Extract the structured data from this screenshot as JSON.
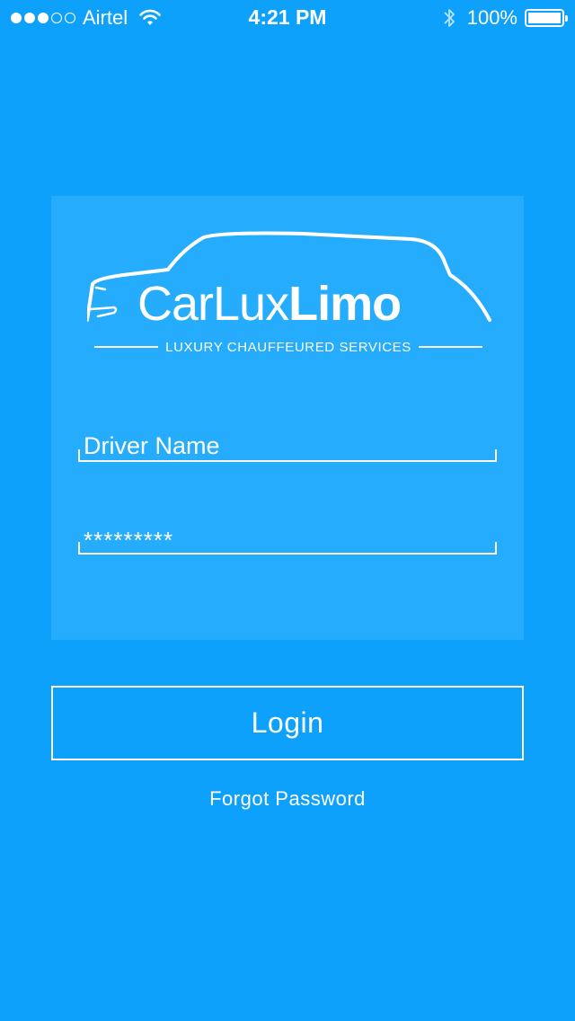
{
  "status_bar": {
    "carrier": "Airtel",
    "time": "4:21 PM",
    "battery": "100%",
    "signal_strength": 3,
    "signal_max": 5
  },
  "logo": {
    "name_light": "CarLux",
    "name_bold": "Limo",
    "tagline": "LUXURY CHAUFFEURED SERVICES"
  },
  "form": {
    "driver_name": "Driver Name",
    "password": "*********"
  },
  "actions": {
    "login_label": "Login",
    "forgot_label": "Forgot Password"
  },
  "colors": {
    "background": "#0ea1fb",
    "card": "#25acfc",
    "foreground": "#ffffff"
  }
}
